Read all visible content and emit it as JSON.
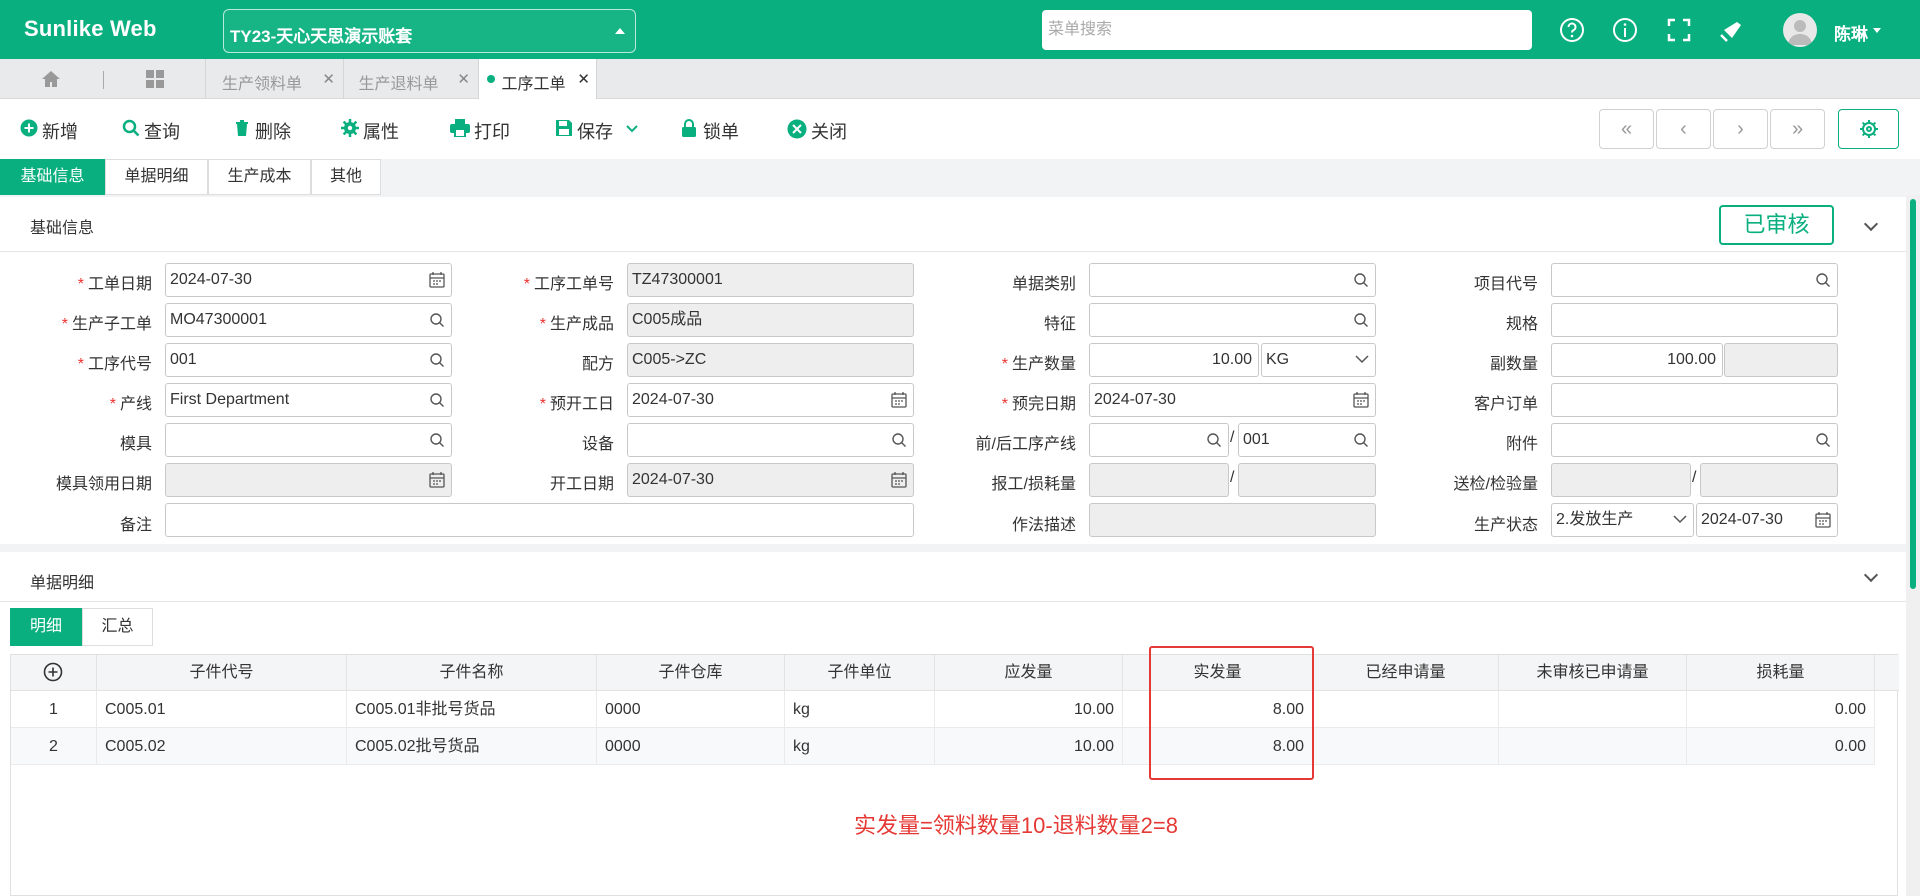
{
  "app": {
    "brand": "Sunlike Web",
    "account": "TY23-天心天思演示账套",
    "menu_search_placeholder": "菜单搜索",
    "user": "陈琳"
  },
  "tabs": [
    {
      "label": "生产领料单"
    },
    {
      "label": "生产退料单"
    },
    {
      "label": "工序工单",
      "active": true
    }
  ],
  "toolbar": {
    "new": "新增",
    "query": "查询",
    "delete": "删除",
    "props": "属性",
    "print": "打印",
    "save": "保存",
    "lock": "锁单",
    "close": "关闭"
  },
  "nav": {
    "first": "«",
    "prev": "‹",
    "next": "›",
    "last": "»"
  },
  "subtabs": [
    "基础信息",
    "单据明细",
    "生产成本",
    "其他"
  ],
  "basic": {
    "title": "基础信息",
    "status": "已审核",
    "fields": {
      "order_date_label": "工单日期",
      "order_date": "2024-07-30",
      "op_no_label": "工序工单号",
      "op_no": "TZ47300001",
      "doc_type_label": "单据类别",
      "doc_type": "",
      "item_code_label": "项目代号",
      "item_code": "",
      "sub_order_label": "生产子工单",
      "sub_order": "MO47300001",
      "product_label": "生产成品",
      "product": "C005成品",
      "feature_label": "特征",
      "feature": "",
      "spec_label": "规格",
      "spec": "",
      "op_code_label": "工序代号",
      "op_code": "001",
      "recipe_label": "配方",
      "recipe": "C005->ZC",
      "qty_label": "生产数量",
      "qty": "10.00",
      "unit": "KG",
      "sub_qty_label": "副数量",
      "sub_qty": "100.00",
      "line_label": "产线",
      "line": "First Department",
      "plan_start_label": "预开工日",
      "plan_start": "2024-07-30",
      "plan_end_label": "预完日期",
      "plan_end": "2024-07-30",
      "customer_order_label": "客户订单",
      "customer_order": "",
      "mold_label": "模具",
      "mold": "",
      "equip_label": "设备",
      "equip": "",
      "prev_next_label": "前/后工序产线",
      "prev_line": "",
      "next_line": "001",
      "attach_label": "附件",
      "attach": "",
      "mold_date_label": "模具领用日期",
      "mold_date": "",
      "start_date_label": "开工日期",
      "start_date": "2024-07-30",
      "report_label": "报工/损耗量",
      "inspect_label": "送检/检验量",
      "remark_label": "备注",
      "remark": "",
      "method_label": "作法描述",
      "method": "",
      "prod_status_label": "生产状态",
      "prod_status": "2.发放生产",
      "prod_status_date": "2024-07-30"
    }
  },
  "detail": {
    "title": "单据明细",
    "tabs": [
      "明细",
      "汇总"
    ],
    "columns": [
      "子件代号",
      "子件名称",
      "子件仓库",
      "子件单位",
      "应发量",
      "实发量",
      "已经申请量",
      "未审核已申请量",
      "损耗量"
    ],
    "rows": [
      {
        "no": "1",
        "code": "C005.01",
        "name": "C005.01非批号货品",
        "wh": "0000",
        "unit": "kg",
        "plan": "10.00",
        "actual": "8.00",
        "applied": "",
        "unapproved": "",
        "loss": "0.00"
      },
      {
        "no": "2",
        "code": "C005.02",
        "name": "C005.02批号货品",
        "wh": "0000",
        "unit": "kg",
        "plan": "10.00",
        "actual": "8.00",
        "applied": "",
        "unapproved": "",
        "loss": "0.00"
      }
    ],
    "note": "实发量=领料数量10-退料数量2=8"
  },
  "colors": {
    "accent": "#0aaf7f",
    "annotation": "#e53935"
  },
  "icons": [
    "home-icon",
    "grid-icon",
    "help-icon",
    "info-icon",
    "fullscreen-icon",
    "clean-icon",
    "calendar-icon",
    "search-icon",
    "gear-icon"
  ]
}
